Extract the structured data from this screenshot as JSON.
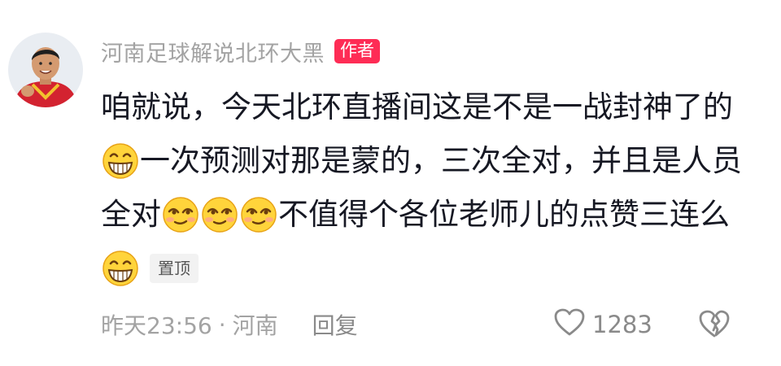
{
  "author": {
    "name": "河南足球解说北环大黑",
    "badge": "作者"
  },
  "comment": {
    "line1": "咱就说，今天北环直播间这是不是一战封神了的",
    "line2": "一次预测对那是蒙的，三次全对，并且是人员",
    "line3_start": "全对",
    "line3_end": "不值得个各位老师儿的点赞三连么",
    "pinned_label": "置顶"
  },
  "footer": {
    "time": "昨天23:56",
    "separator": "·",
    "location": "河南",
    "reply": "回复",
    "like_count": "1283"
  },
  "icons": {
    "emoji_grin": "grinning-emoji",
    "emoji_wink": "smirking-emoji",
    "like": "heart-outline-icon",
    "dislike": "broken-heart-icon"
  },
  "colors": {
    "author_badge_bg": "#fe2c55",
    "text_primary": "#161823",
    "text_secondary": "#a3a3a3"
  }
}
